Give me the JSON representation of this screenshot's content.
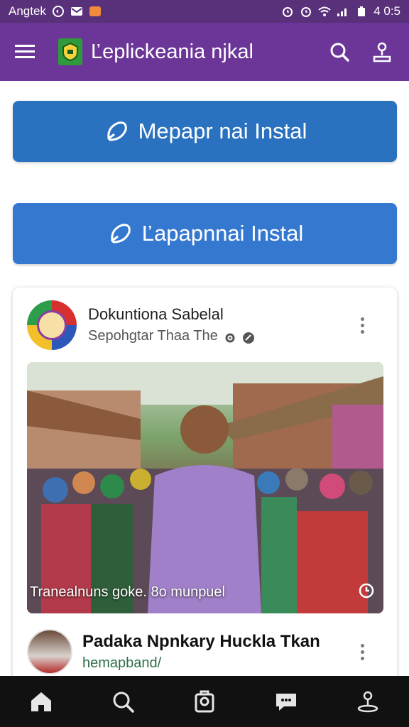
{
  "status_bar": {
    "carrier": "Angtek",
    "time": "4 0:5"
  },
  "app_bar": {
    "title": "Ľeplickeania njkal"
  },
  "install_buttons": [
    {
      "label": "Mepapr nai Instal"
    },
    {
      "label": "Ľapapnnai Instal"
    }
  ],
  "post": {
    "author": "Dokuntiona Sabelal",
    "subtitle": "Sepohgtar Thaa The",
    "photo_caption": "Tranealnuns goke. 8o munpuel"
  },
  "post2": {
    "author": "Padaka Npnkary Huckla Tkan",
    "subtitle": "hemapband/"
  },
  "colors": {
    "status_bar": "#59307a",
    "app_bar": "#6b3698",
    "install_button_1": "#2a72c0",
    "install_button_2": "#3578d0",
    "bottom_nav": "#111111"
  },
  "icons": {
    "menu": "hamburger-icon",
    "search": "search-icon",
    "profile": "location-person-icon",
    "install": "rocket-icon",
    "nav": [
      "home-icon",
      "search-icon",
      "store-icon",
      "chat-icon",
      "location-person-icon"
    ]
  }
}
